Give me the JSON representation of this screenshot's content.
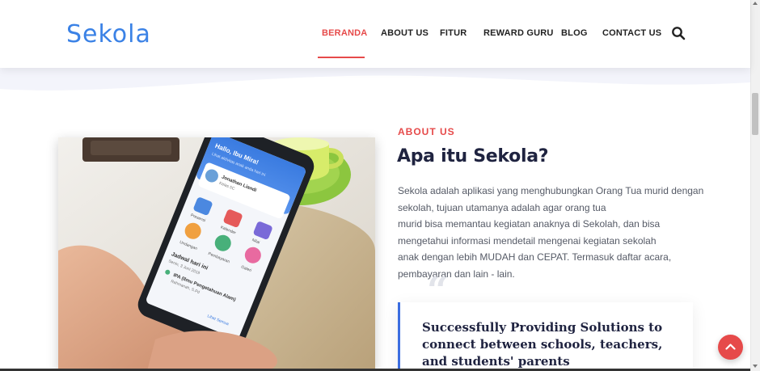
{
  "brand": {
    "logo_text": "Sekola",
    "accent": "#3b82e6",
    "highlight": "#e64a4a"
  },
  "nav": {
    "items": [
      {
        "label": "BERANDA",
        "active": true
      },
      {
        "label": "ABOUT US",
        "active": false
      },
      {
        "label": "FITUR",
        "active": false
      },
      {
        "label": "REWARD GURU",
        "active": false
      },
      {
        "label": "BLOG",
        "active": false
      },
      {
        "label": "CONTACT US",
        "active": false
      }
    ],
    "search_icon": "search-icon"
  },
  "about": {
    "label": "ABOUT US",
    "title": "Apa itu Sekola?",
    "description_lines": [
      "Sekola adalah aplikasi yang menghubungkan Orang Tua murid dengan",
      "sekolah, tujuan utamanya adalah agar orang tua",
      "murid bisa memantau kegiatan anaknya di Sekolah, dan bisa",
      "mengetahui informasi mendetail mengenai kegiatan sekolah",
      "anak dengan lebih MUDAH dan CEPAT. Termasuk daftar acara,",
      "pembayaran dan lain - lain."
    ],
    "quote_mark": "“",
    "quote": "Successfully Providing Solutions to connect between schools, teachers, and students' parents"
  },
  "phone_screen": {
    "greeting": "Hallo, Ibu Mira!",
    "subtitle": "Lihat aktivitas anak anda hari ini",
    "student_name": "Jonathan Liandi",
    "student_class": "Kelas 5C",
    "menu": [
      "Presensi",
      "Kalender",
      "Undangan",
      "Pembayaran",
      "Nilai",
      "Galeri"
    ],
    "schedule_title": "Jadwal hari ini",
    "schedule_date": "Senin, 3 Juni 2019",
    "schedule_item": "IPA (Ilmu Pengetahuan Alam)",
    "schedule_teacher": "Rahmanah, S.Pd",
    "see_all": "Lihat Semua"
  },
  "back_to_top_icon": "chevron-up-icon"
}
